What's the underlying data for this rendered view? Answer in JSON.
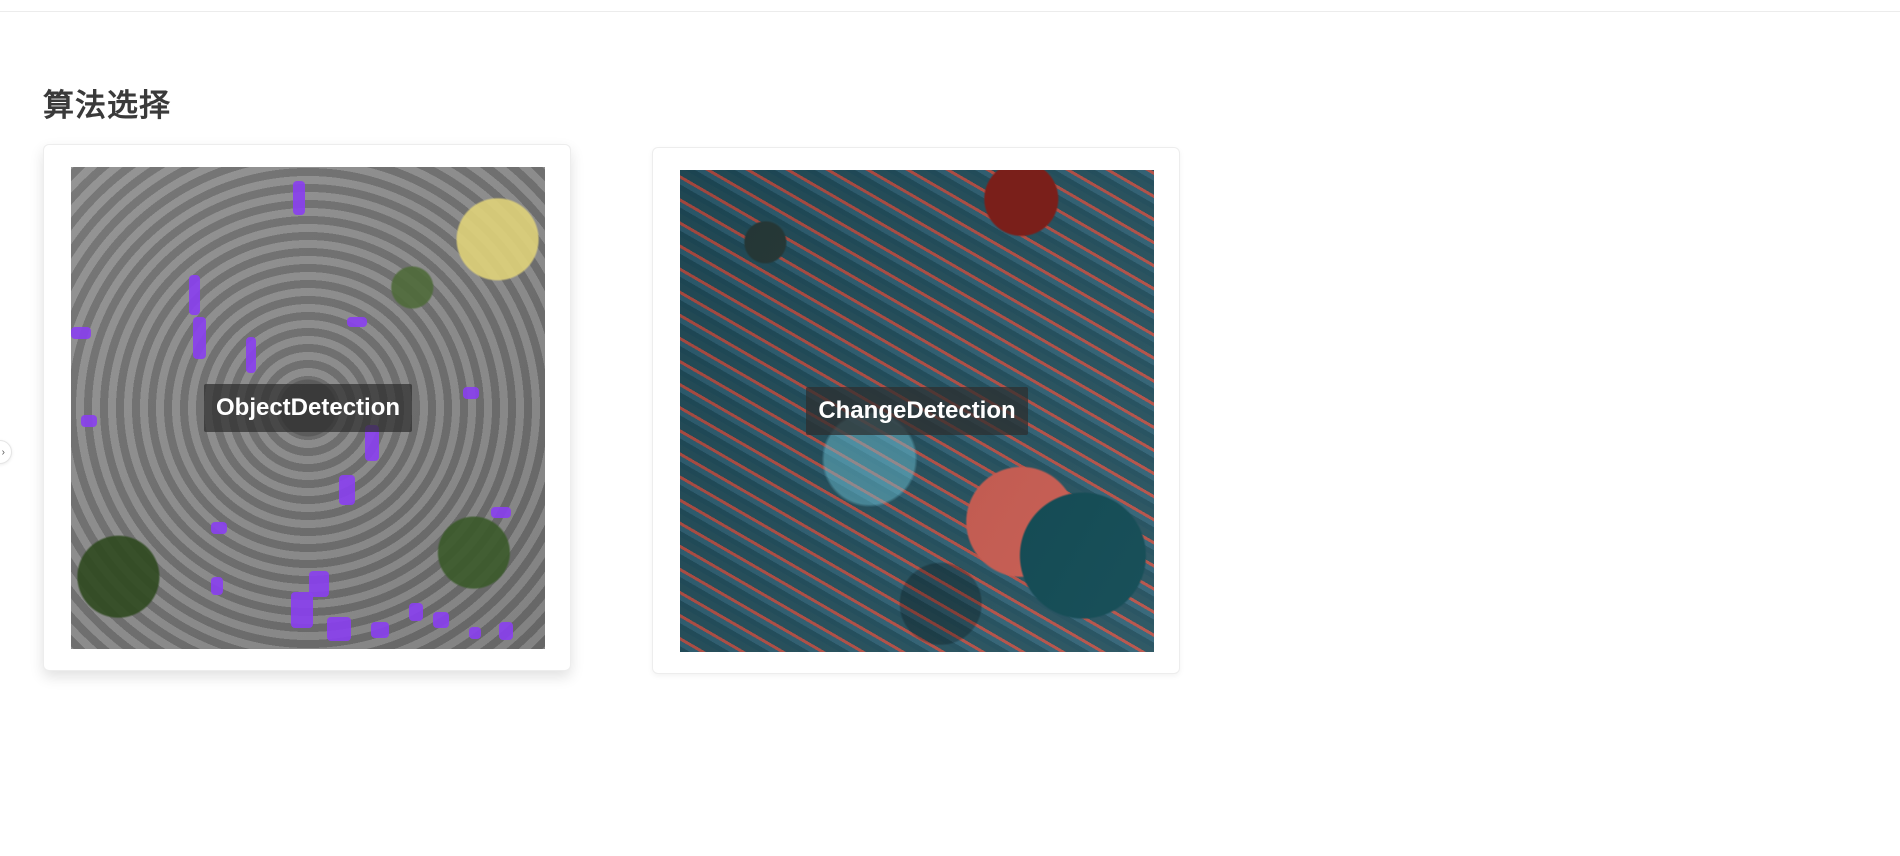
{
  "page": {
    "section_title": "算法选择"
  },
  "side_handle": {
    "icon": "chevron-right-icon"
  },
  "algorithms": [
    {
      "label": "ObjectDetection",
      "selected": true,
      "thumbnail": "aerial-traffic-detection-preview"
    },
    {
      "label": "ChangeDetection",
      "selected": false,
      "thumbnail": "aerial-change-detection-preview"
    }
  ]
}
